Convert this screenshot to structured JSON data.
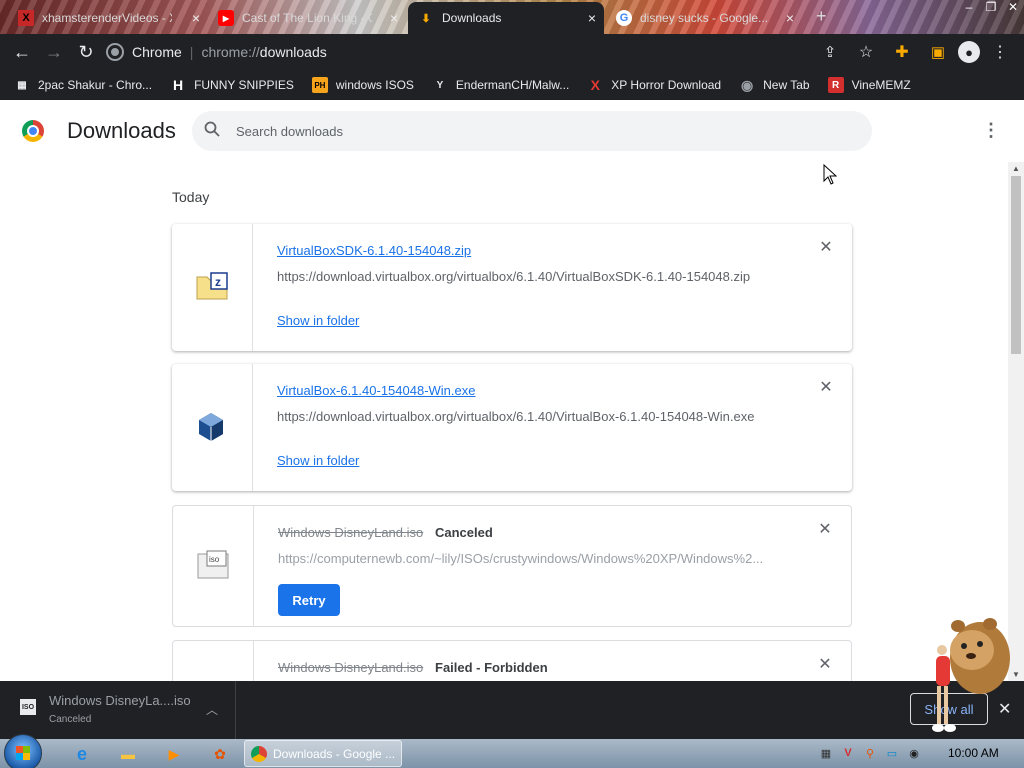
{
  "tabs": [
    {
      "label": "xhamsterenderVideos - Xv...",
      "icon": "X",
      "active": false
    },
    {
      "label": "Cast of The Lion King - C...",
      "icon": "youtube",
      "active": false
    },
    {
      "label": "Downloads",
      "icon": "download",
      "active": true
    },
    {
      "label": "disney sucks - Google...",
      "icon": "google",
      "active": false
    }
  ],
  "toolbar": {
    "site_label": "Chrome",
    "url_scheme": "chrome://",
    "url_host": "downloads"
  },
  "bookmarks": [
    {
      "label": "2pac Shakur - Chro...",
      "icon_color": "#e8eaed",
      "glyph": "▦"
    },
    {
      "label": "FUNNY SNIPPIES",
      "icon_color": "#ffffff",
      "glyph": "H"
    },
    {
      "label": "windows ISOS",
      "icon_color": "#f7a41d",
      "glyph": "PH"
    },
    {
      "label": "EndermanCH/Malw...",
      "icon_color": "#5f6368",
      "glyph": "Y"
    },
    {
      "label": "XP Horror Download",
      "icon_color": "#e53935",
      "glyph": "X"
    },
    {
      "label": "New Tab",
      "icon_color": "#9aa0a6",
      "glyph": "◉"
    },
    {
      "label": "VineMEMZ",
      "icon_color": "#d32f2f",
      "glyph": "R"
    }
  ],
  "page": {
    "title": "Downloads",
    "search_placeholder": "Search downloads",
    "section": "Today"
  },
  "downloads": [
    {
      "filename": "VirtualBoxSDK-6.1.40-154048.zip",
      "url": "https://download.virtualbox.org/virtualbox/6.1.40/VirtualBoxSDK-6.1.40-154048.zip",
      "action": "Show in folder",
      "status": ""
    },
    {
      "filename": "VirtualBox-6.1.40-154048-Win.exe",
      "url": "https://download.virtualbox.org/virtualbox/6.1.40/VirtualBox-6.1.40-154048-Win.exe",
      "action": "Show in folder",
      "status": ""
    },
    {
      "filename": "Windows DisneyLand.iso",
      "url": "https://computernewb.com/~lily/ISOs/crustywindows/Windows%20XP/Windows%2...",
      "action": "Retry",
      "status": "Canceled"
    },
    {
      "filename": "Windows DisneyLand.iso",
      "url": "",
      "action": "",
      "status": "Failed - Forbidden"
    }
  ],
  "shelf": {
    "name": "Windows DisneyLa....iso",
    "status": "Canceled",
    "show_all": "Show all",
    "iso_label": "ISO"
  },
  "taskbar": {
    "window_label": "Downloads - Google ...",
    "clock": "10:00 AM"
  }
}
